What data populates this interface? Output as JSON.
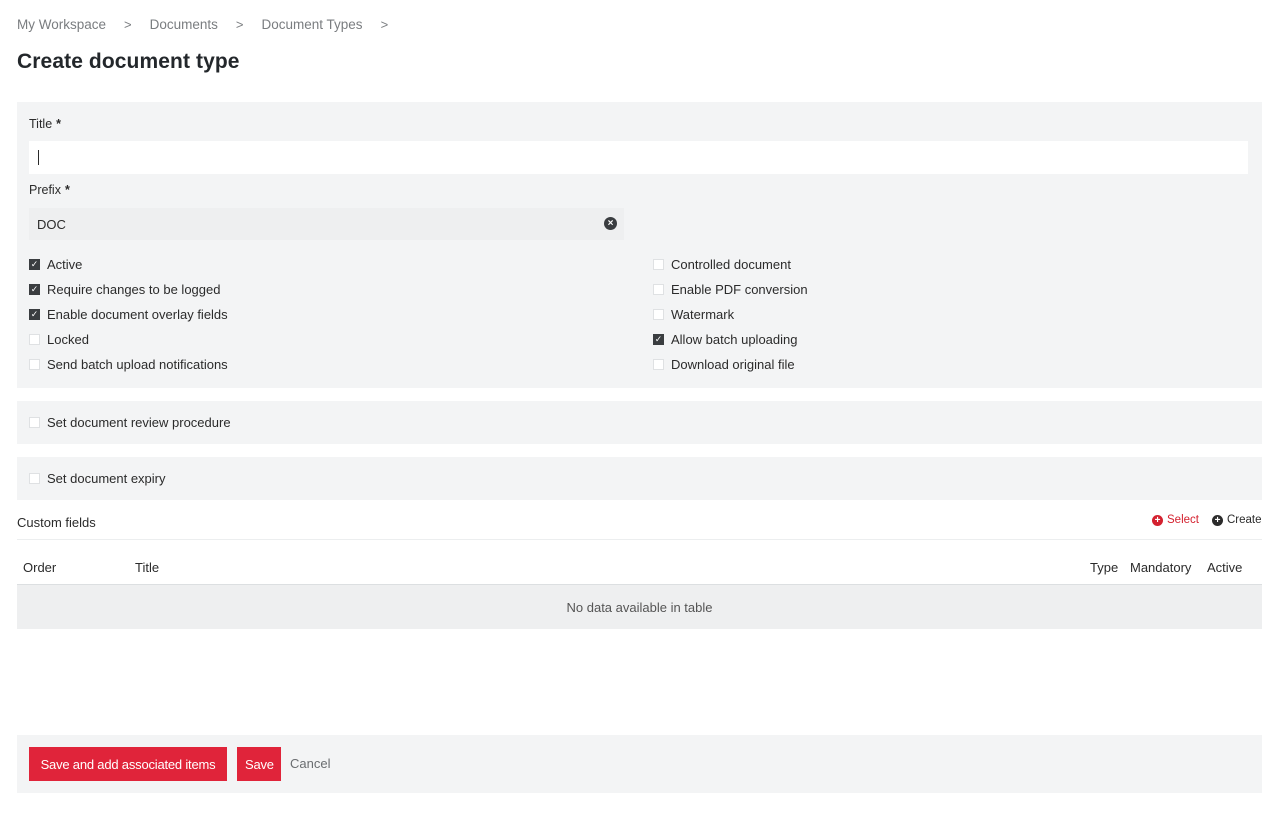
{
  "breadcrumb": [
    "My Workspace",
    "Documents",
    "Document Types"
  ],
  "breadcrumb_separator": ">",
  "page_title": "Create document type",
  "form": {
    "title_label": "Title",
    "title_value": "",
    "prefix_label": "Prefix",
    "prefix_value": "DOC",
    "required_mark": "*",
    "clear_icon": "×"
  },
  "options_left": [
    {
      "label": "Active",
      "checked": true
    },
    {
      "label": "Require changes to be logged",
      "checked": true
    },
    {
      "label": "Enable document overlay fields",
      "checked": true
    },
    {
      "label": "Locked",
      "checked": false
    },
    {
      "label": "Send batch upload notifications",
      "checked": false
    }
  ],
  "options_right": [
    {
      "label": "Controlled document",
      "checked": false
    },
    {
      "label": "Enable PDF conversion",
      "checked": false
    },
    {
      "label": "Watermark",
      "checked": false
    },
    {
      "label": "Allow batch uploading",
      "checked": true
    },
    {
      "label": "Download original file",
      "checked": false
    }
  ],
  "review": {
    "label": "Set document review procedure",
    "checked": false
  },
  "expiry": {
    "label": "Set document expiry",
    "checked": false
  },
  "custom_fields": {
    "title": "Custom fields",
    "select_label": "Select",
    "create_label": "Create",
    "select_icon": "+",
    "create_icon": "+",
    "columns": {
      "order": "Order",
      "title": "Title",
      "type": "Type",
      "mandatory": "Mandatory",
      "active": "Active"
    },
    "empty_message": "No data available in table"
  },
  "footer": {
    "save_add_label": "Save and add associated items",
    "save_label": "Save",
    "cancel_label": "Cancel"
  },
  "colors": {
    "accent": "#e0243a",
    "panel": "#f3f4f5",
    "checked": "#3a3d40"
  }
}
